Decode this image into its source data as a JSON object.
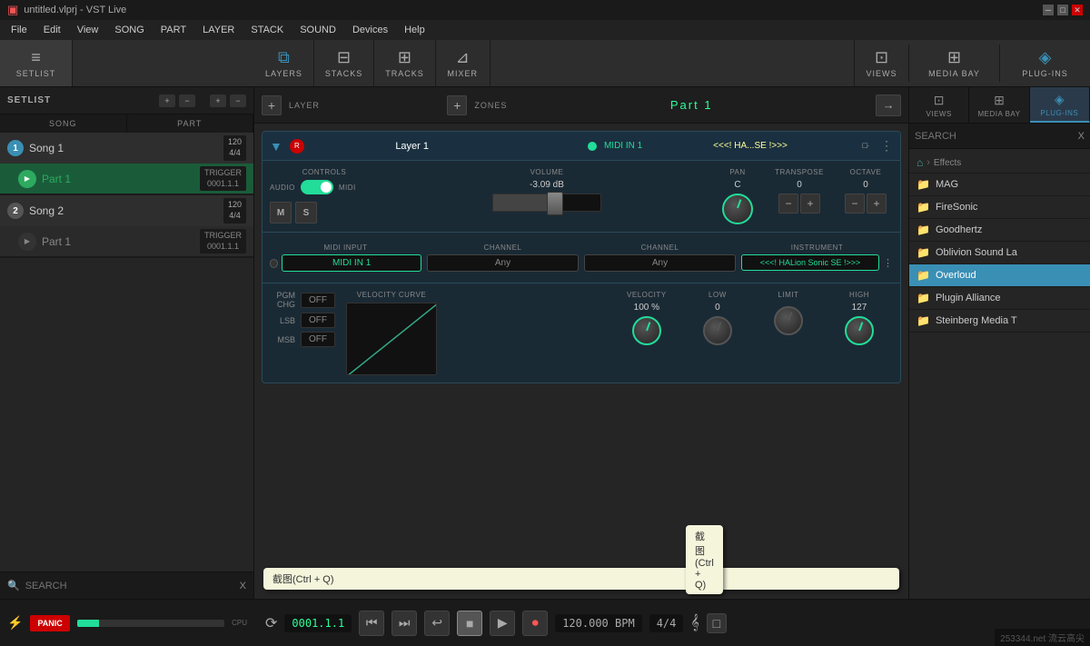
{
  "titlebar": {
    "title": "untitled.vlprj - VST Live",
    "logo": "▣",
    "controls": [
      "─",
      "□",
      "✕"
    ]
  },
  "menubar": {
    "items": [
      "File",
      "Edit",
      "View",
      "SONG",
      "PART",
      "LAYER",
      "STACK",
      "SOUND",
      "Devices",
      "Help"
    ]
  },
  "toolbar": {
    "sections": [
      {
        "id": "setlist",
        "icon": "≡",
        "label": "SETLIST"
      },
      {
        "id": "layers",
        "icon": "⧉",
        "label": "LAYERS"
      },
      {
        "id": "stacks",
        "icon": "⊟",
        "label": "STACKS"
      },
      {
        "id": "tracks",
        "icon": "⊞",
        "label": "TRACKS"
      },
      {
        "id": "mixer",
        "icon": "⊿",
        "label": "MIXER"
      }
    ],
    "right_sections": [
      {
        "id": "views",
        "icon": "⊡",
        "label": "VIEWS"
      },
      {
        "id": "media_bay",
        "icon": "⊞",
        "label": "MEDIA BAY"
      },
      {
        "id": "plugins",
        "icon": "◈",
        "label": "PLUG-INS"
      }
    ]
  },
  "setlist": {
    "title": "SETLIST",
    "add_song_label": "+",
    "remove_song_label": "−",
    "add_part_label": "+",
    "remove_part_label": "−",
    "song_col": "SONG",
    "part_col": "PART",
    "songs": [
      {
        "num": "1",
        "name": "Song 1",
        "time": "120\n4/4",
        "parts": [
          {
            "name": "Part 1",
            "active": true,
            "trigger": "TRIGGER\n0001.1.1"
          }
        ]
      },
      {
        "num": "2",
        "name": "Song 2",
        "time": "120\n4/4",
        "parts": [
          {
            "name": "Part 1",
            "active": false,
            "trigger": "TRIGGER\n0001.1.1"
          }
        ]
      }
    ]
  },
  "center": {
    "layer_zone_label": "LAYER",
    "zones_label": "ZONES",
    "part_name": "Part 1",
    "layer": {
      "name": "Layer 1",
      "rec": "R",
      "midi_in": "MIDI IN 1",
      "preset": "<<<! HA...SE !>>>",
      "active": true,
      "controls_label": "CONTROLS",
      "audio_label": "AUDIO",
      "midi_label": "MIDI",
      "volume_label": "VOLUME",
      "volume_val": "-3.09 dB",
      "pan_label": "PAN",
      "pan_val": "C",
      "transpose_label": "TRANSPOSE",
      "transpose_val": "0",
      "octave_label": "OCTAVE",
      "octave_val": "0",
      "m_label": "M",
      "s_label": "S",
      "midi_input_label": "MIDI INPUT",
      "midi_input_val": "MIDI IN 1",
      "channel_label": "CHANNEL",
      "channel_val": "Any",
      "channel2_label": "CHANNEL",
      "channel2_val": "Any",
      "instrument_label": "INSTRUMENT",
      "instrument_val": "<<<! HALion Sonic SE !>>>",
      "pgm_chg_label": "PGM CHG",
      "pgm_chg_val": "OFF",
      "lsb_label": "LSB",
      "lsb_val": "OFF",
      "msb_label": "MSB",
      "msb_val": "OFF",
      "velocity_curve_label": "VELOCITY CURVE",
      "velocity_label": "VELOCITY",
      "velocity_val": "100 %",
      "low_label": "LOW",
      "low_val": "0",
      "limit_label": "LIMIT",
      "high_label": "HIGH",
      "high_val": "127"
    }
  },
  "right_panel": {
    "search_placeholder": "SEARCH",
    "clear_label": "X",
    "views_label": "VIEWS",
    "media_bay_label": "MEDIA BAY",
    "plugins_label": "PLUG-INS",
    "effects_path": "Effects",
    "tree_items": [
      {
        "label": "MAG",
        "type": "folder"
      },
      {
        "label": "FireSonic",
        "type": "folder"
      },
      {
        "label": "Goodhertz",
        "type": "folder"
      },
      {
        "label": "Oblivion Sound La",
        "type": "folder"
      },
      {
        "label": "Overloud",
        "type": "folder",
        "selected": true
      },
      {
        "label": "Plugin Alliance",
        "type": "folder"
      },
      {
        "label": "Steinberg Media T",
        "type": "folder"
      }
    ]
  },
  "transport": {
    "position": "0001.1.1",
    "bpm": "120.000 BPM",
    "meter": "4/4",
    "buttons": [
      "⏮",
      "⏭",
      "↩",
      "■",
      "▶",
      "⏺"
    ]
  },
  "bottom": {
    "panic_label": "PANIC",
    "cpu_label": "CPU",
    "watermark": "253344.net 流云高尖"
  },
  "tooltip": {
    "text": "截图(Ctrl + Q)",
    "visible": true
  }
}
